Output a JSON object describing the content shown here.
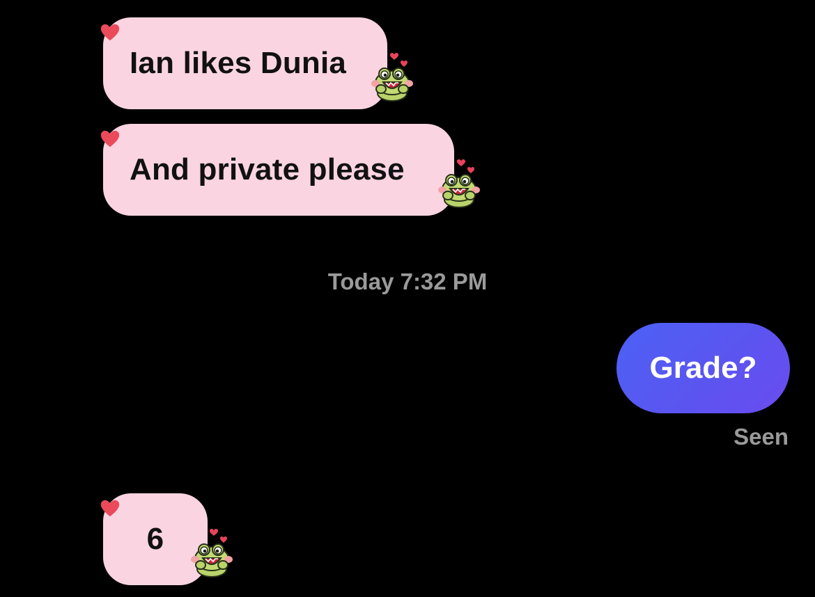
{
  "conversation": {
    "messages": [
      {
        "sender": "other",
        "text": "Ian likes Dunia",
        "reaction": "heart-icon",
        "sticker": "frog-sticker"
      },
      {
        "sender": "other",
        "text": "And private please",
        "reaction": "heart-icon",
        "sticker": "frog-sticker"
      },
      {
        "sender": "self",
        "text": "Grade?"
      },
      {
        "sender": "other",
        "text": "6",
        "reaction": "heart-icon",
        "sticker": "frog-sticker"
      }
    ],
    "timestamp": "Today 7:32 PM",
    "status": "Seen"
  },
  "colors": {
    "background": "#000000",
    "incoming_bubble": "#fbd4e2",
    "outgoing_bubble_start": "#4b61f5",
    "outgoing_bubble_end": "#6a4bef",
    "heart": "#ea4a5a",
    "meta_text": "#9a9a9a"
  }
}
